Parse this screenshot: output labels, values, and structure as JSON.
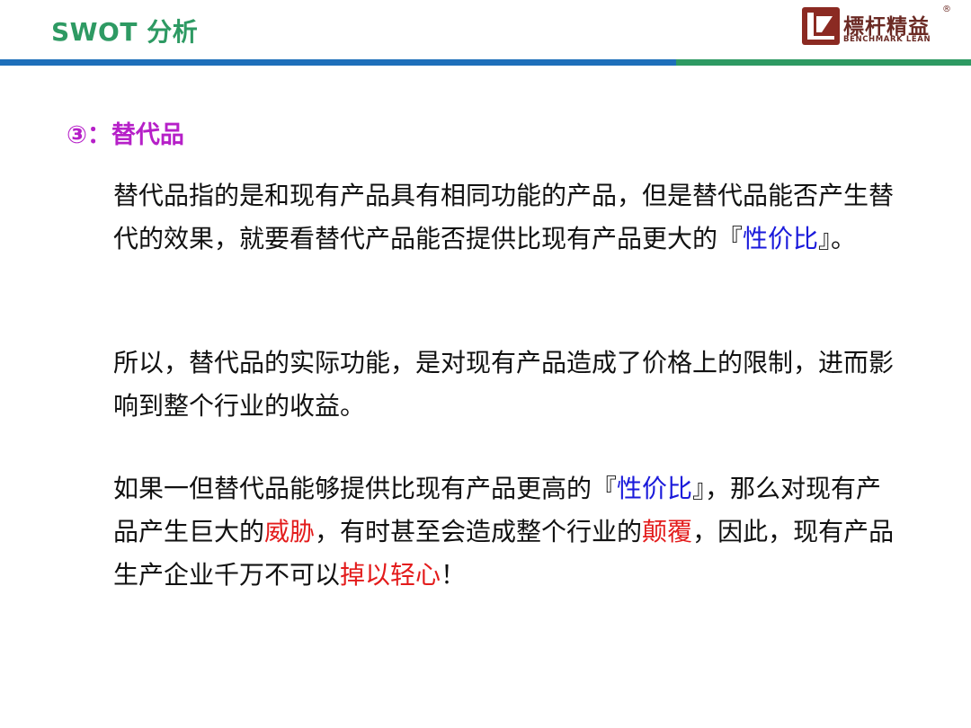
{
  "header": {
    "title": "SWOT 分析",
    "logo": {
      "name_cn": "標杆精益",
      "name_en": "BENCHMARK LEAN",
      "reg_mark": "®",
      "icon": "benchmark-lean-logo-icon"
    }
  },
  "section": {
    "heading": "③：替代品"
  },
  "paragraphs": {
    "p1": {
      "t1": "替代品指的是和现有产品具有相同功能的产品，但是替代品能否产生替代的效果，就要看替代产品能否提供比现有产品更大的『",
      "hl1": "性价比",
      "t2": "』。"
    },
    "p2": {
      "t1": "所以，替代品的实际功能，是对现有产品造成了价格上的限制，进而影响到整个行业的收益。"
    },
    "p3": {
      "t1": "如果一但替代品能够提供比现有产品更高的『",
      "hl1": "性价比",
      "t2": "』，那么对现有产品产生巨大的",
      "hl2": "威胁",
      "t3": "，有时甚至会造成整个行业的",
      "hl3": "颠覆",
      "t4": "，因此，现有产品生产企业千万不可以",
      "hl4": "掉以轻心",
      "t5": "！"
    }
  },
  "colors": {
    "title_green": "#2e9a63",
    "rule_blue": "#1e6fba",
    "heading_magenta": "#b620c8",
    "highlight_blue": "#1a1adb",
    "highlight_red": "#e31b1b",
    "logo_brown": "#6b2a24"
  }
}
